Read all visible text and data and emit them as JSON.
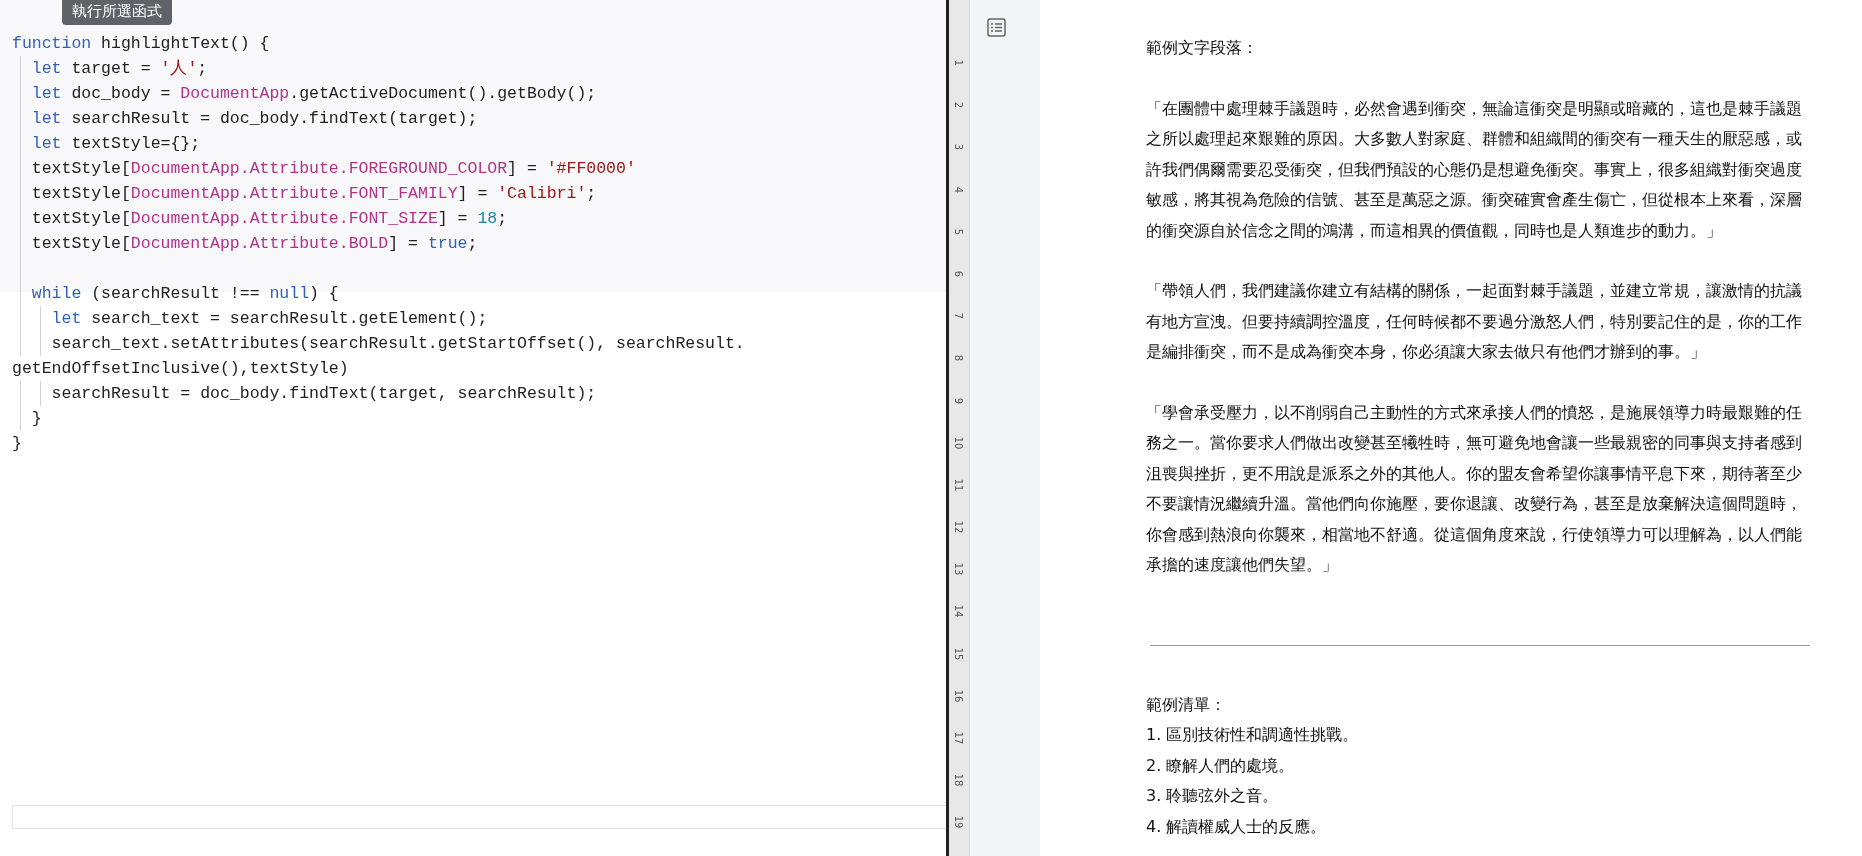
{
  "tooltip": "執行所選函式",
  "code": {
    "lines": [
      {
        "tokens": [
          {
            "kind": "keyword",
            "text": "function"
          },
          {
            "kind": "plain",
            "text": " highlightText() {"
          }
        ]
      },
      {
        "tokens": [
          {
            "kind": "keyword",
            "text": "  let"
          },
          {
            "kind": "plain",
            "text": " target = "
          },
          {
            "kind": "string",
            "text": "'人'"
          },
          {
            "kind": "plain",
            "text": ";"
          }
        ]
      },
      {
        "tokens": [
          {
            "kind": "keyword",
            "text": "  let"
          },
          {
            "kind": "plain",
            "text": " doc_body = "
          },
          {
            "kind": "class",
            "text": "DocumentApp"
          },
          {
            "kind": "plain",
            "text": ".getActiveDocument().getBody();"
          }
        ]
      },
      {
        "tokens": [
          {
            "kind": "keyword",
            "text": "  let"
          },
          {
            "kind": "plain",
            "text": " searchResult = doc_body.findText(target);"
          }
        ]
      },
      {
        "tokens": [
          {
            "kind": "keyword",
            "text": "  let"
          },
          {
            "kind": "plain",
            "text": " textStyle={};"
          }
        ]
      },
      {
        "tokens": [
          {
            "kind": "plain",
            "text": "  textStyle["
          },
          {
            "kind": "class",
            "text": "DocumentApp.Attribute.FOREGROUND_COLOR"
          },
          {
            "kind": "plain",
            "text": "] = "
          },
          {
            "kind": "string",
            "text": "'#FF0000'"
          }
        ]
      },
      {
        "tokens": [
          {
            "kind": "plain",
            "text": "  textStyle["
          },
          {
            "kind": "class",
            "text": "DocumentApp.Attribute.FONT_FAMILY"
          },
          {
            "kind": "plain",
            "text": "] = "
          },
          {
            "kind": "string",
            "text": "'Calibri'"
          },
          {
            "kind": "plain",
            "text": ";"
          }
        ]
      },
      {
        "tokens": [
          {
            "kind": "plain",
            "text": "  textStyle["
          },
          {
            "kind": "class",
            "text": "DocumentApp.Attribute.FONT_SIZE"
          },
          {
            "kind": "plain",
            "text": "] = "
          },
          {
            "kind": "number",
            "text": "18"
          },
          {
            "kind": "plain",
            "text": ";"
          }
        ]
      },
      {
        "tokens": [
          {
            "kind": "plain",
            "text": "  textStyle["
          },
          {
            "kind": "class",
            "text": "DocumentApp.Attribute.BOLD"
          },
          {
            "kind": "plain",
            "text": "] = "
          },
          {
            "kind": "keyword",
            "text": "true"
          },
          {
            "kind": "plain",
            "text": ";"
          }
        ]
      },
      {
        "kind": "blank"
      },
      {
        "tokens": [
          {
            "kind": "keyword",
            "text": "  while"
          },
          {
            "kind": "plain",
            "text": " (searchResult !== "
          },
          {
            "kind": "keyword",
            "text": "null"
          },
          {
            "kind": "plain",
            "text": ") {"
          }
        ]
      },
      {
        "tokens": [
          {
            "kind": "keyword",
            "text": "    let"
          },
          {
            "kind": "plain",
            "text": " search_text = searchResult.getElement();"
          }
        ]
      },
      {
        "tokens": [
          {
            "kind": "plain",
            "text": "    search_text.setAttributes(searchResult.getStartOffset(), searchResult."
          }
        ]
      },
      {
        "tokens": [
          {
            "kind": "plain",
            "text": "getEndOffsetInclusive(),textStyle)"
          }
        ]
      },
      {
        "tokens": [
          {
            "kind": "plain",
            "text": "    searchResult = doc_body.findText(target, searchResult);"
          }
        ]
      },
      {
        "tokens": [
          {
            "kind": "plain",
            "text": "  }"
          }
        ]
      },
      {
        "tokens": [
          {
            "kind": "plain",
            "text": "}"
          }
        ]
      }
    ]
  },
  "ruler_marks": [
    "1",
    "2",
    "3",
    "4",
    "5",
    "6",
    "7",
    "8",
    "9",
    "10",
    "11",
    "12",
    "13",
    "14",
    "15",
    "16",
    "17",
    "18",
    "19"
  ],
  "document": {
    "heading": "範例文字段落：",
    "paragraphs": [
      {
        "lines": [
          "「在團體中處理棘手議題時，必然會遇到衝突，無論這衝突是明顯或暗藏的，這也是棘手議題",
          "之所以處理起來艱難的原因。大多數人對家庭、群體和組織間的衝突有一種天生的厭惡感，或",
          "許我們偶爾需要忍受衝突，但我們預設的心態仍是想避免衝突。事實上，很多組織對衝突過度",
          "敏感，將其視為危險的信號、甚至是萬惡之源。衝突確實會產生傷亡，但從根本上來看，深層",
          "的衝突源自於信念之間的鴻溝，而這相異的價值觀，同時也是人類進步的動力。」"
        ]
      },
      {
        "lines": [
          "「帶領人們，我們建議你建立有結構的關係，一起面對棘手議題，並建立常規，讓激情的抗議",
          "有地方宣洩。但要持續調控溫度，任何時候都不要過分激怒人們，特別要記住的是，你的工作",
          "是編排衝突，而不是成為衝突本身，你必須讓大家去做只有他們才辦到的事。」"
        ]
      },
      {
        "lines": [
          "「學會承受壓力，以不削弱自己主動性的方式來承接人們的憤怒，是施展領導力時最艱難的任",
          "務之一。當你要求人們做出改變甚至犧牲時，無可避免地會讓一些最親密的同事與支持者感到",
          "沮喪與挫折，更不用說是派系之外的其他人。你的盟友會希望你讓事情平息下來，期待著至少",
          "不要讓情況繼續升溫。當他們向你施壓，要你退讓、改變行為，甚至是放棄解決這個問題時，",
          "你會感到熱浪向你襲來，相當地不舒適。從這個角度來說，行使領導力可以理解為，以人們能",
          "承擔的速度讓他們失望。」"
        ]
      }
    ],
    "list_title": "範例清單：",
    "list_items": [
      "1. 區別技術性和調適性挑戰。",
      "2. 瞭解人們的處境。",
      "3. 聆聽弦外之音。",
      "4. 解讀權威人士的反應。"
    ]
  }
}
